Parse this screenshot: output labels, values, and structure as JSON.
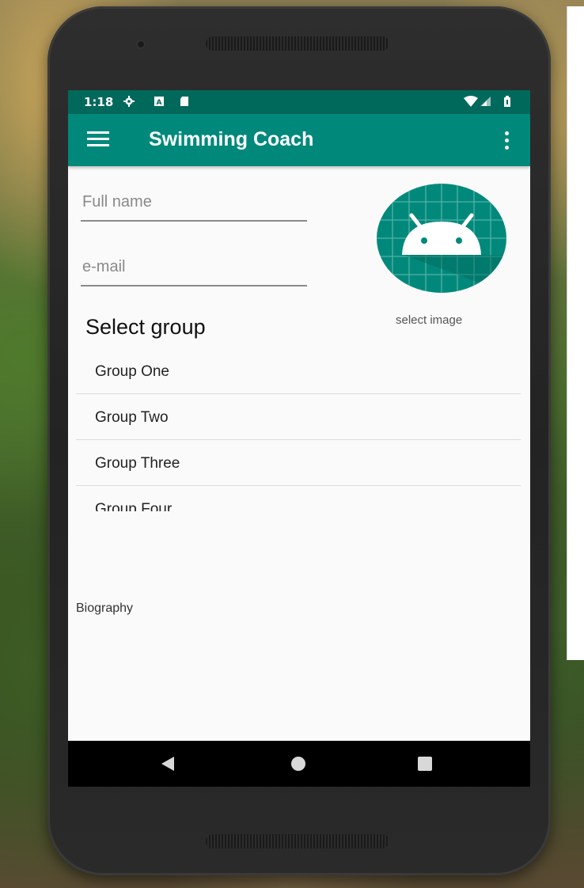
{
  "status_bar": {
    "time": "1:18",
    "icons": [
      "settings-icon",
      "a-icon",
      "sd-card-icon",
      "wifi-icon",
      "signal-icon",
      "battery-icon"
    ]
  },
  "app_bar": {
    "title": "Swimming Coach",
    "menu_icon": "menu-icon",
    "overflow_icon": "more-vert-icon"
  },
  "form": {
    "full_name_placeholder": "Full name",
    "full_name_value": "",
    "email_placeholder": "e-mail",
    "email_value": "",
    "select_image_label": "select image",
    "select_group_title": "Select group",
    "groups": [
      "Group One",
      "Group Two",
      "Group Three",
      "Group Four"
    ],
    "biography_label": "Biography"
  },
  "nav_bar": {
    "buttons": [
      "back-icon",
      "home-icon",
      "recents-icon"
    ]
  },
  "colors": {
    "primary": "#00897b",
    "primary_dark": "#00695c",
    "avatar_bg": "#00897b",
    "background": "#fafafa"
  }
}
